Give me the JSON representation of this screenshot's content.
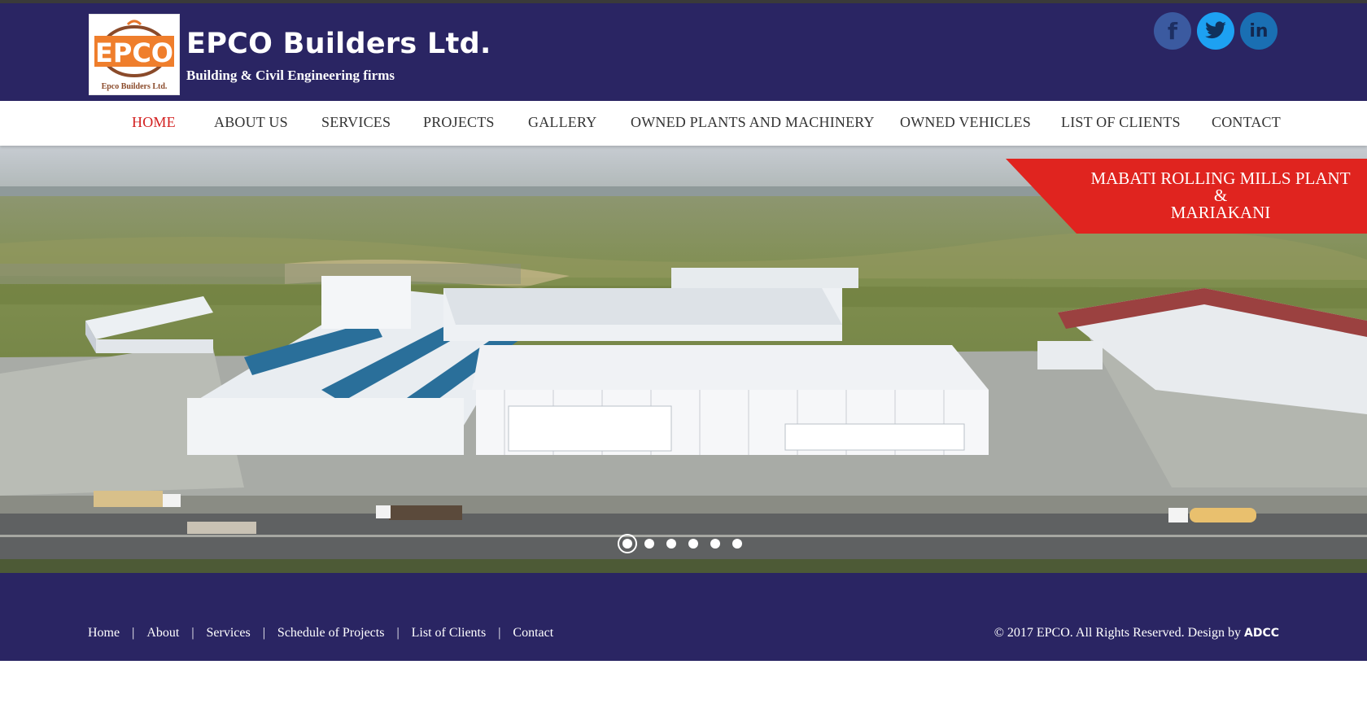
{
  "header": {
    "logo_text": "EPCO",
    "logo_caption": "Epco Builders Ltd.",
    "title": "EPCO Builders Ltd.",
    "subtitle": "Building & Civil Engineering firms",
    "social": [
      {
        "name": "facebook",
        "icon": "facebook-icon",
        "glyph": "f",
        "color": "#3b5aa0"
      },
      {
        "name": "twitter",
        "icon": "twitter-icon",
        "color": "#1da1f2"
      },
      {
        "name": "linkedin",
        "icon": "linkedin-icon",
        "glyph": "in",
        "color": "#1a6fb3"
      }
    ]
  },
  "nav": {
    "items": [
      {
        "label": "HOME",
        "active": true
      },
      {
        "label": "ABOUT US"
      },
      {
        "label": "SERVICES"
      },
      {
        "label": "PROJECTS"
      },
      {
        "label": "GALLERY"
      },
      {
        "label": "OWNED PLANTS AND MACHINERY"
      },
      {
        "label": "OWNED VEHICLES"
      },
      {
        "label": "LIST OF CLIENTS"
      },
      {
        "label": "CONTACT"
      }
    ],
    "active_color": "#d32020"
  },
  "hero": {
    "caption_lines": [
      "MABATI ROLLING MILLS PLANT",
      "&",
      "MARIAKANI"
    ],
    "caption_color": "#e0241f",
    "slide_count": 6,
    "active_slide": 1
  },
  "footer": {
    "links": [
      "Home",
      "About",
      "Services",
      "Schedule of Projects",
      "List of Clients",
      "Contact"
    ],
    "separator": "|",
    "copyright": "© 2017 EPCO. All Rights Reserved. Design by",
    "designer": "ADCC"
  },
  "colors": {
    "brand_navy": "#2a2563",
    "accent_red": "#e0241f"
  }
}
